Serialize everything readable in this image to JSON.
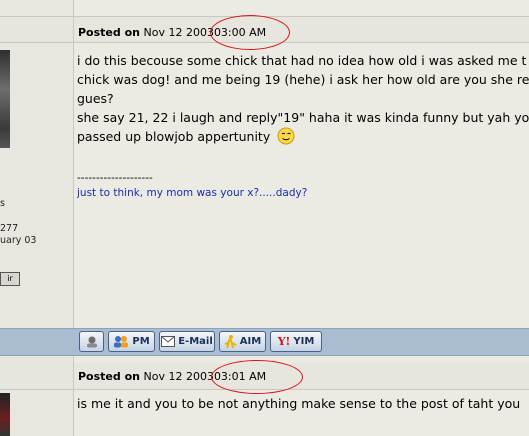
{
  "post1": {
    "posted_on_label": "Posted on",
    "date": "Nov 12 2003",
    "time": "03:00 AM",
    "body_lines": [
      "i do this becouse some chick that had no idea how old i was asked me t",
      "chick was dog! and me being 19 (hehe) i ask her how old are you she re",
      "gues?",
      "she say 21, 22 i laugh and reply\"19\" haha it was kinda funny but yah yo",
      "passed up blowjob appertunity"
    ],
    "smiley_icon": "wink-smiley-icon",
    "sig_divider": "--------------------",
    "signature": "just to think, my mom was your x?.....dady?"
  },
  "sidebar": {
    "lines": [
      "s",
      "277",
      "uary 03"
    ],
    "badge": "ir"
  },
  "buttons": {
    "profile_icon": "profile-icon",
    "pm_label": "PM",
    "email_label": "E-Mail",
    "aim_label": "AIM",
    "yim_label": "YIM"
  },
  "post2": {
    "posted_on_label": "Posted on",
    "date": "Nov 12 2003",
    "time": "03:01 AM",
    "body_line": "is me it and you to be not anything make sense to the post of taht you"
  },
  "colors": {
    "annotation_circle": "#d91616",
    "signature_text": "#1a2fa8",
    "button_bar": "#aabccf"
  }
}
